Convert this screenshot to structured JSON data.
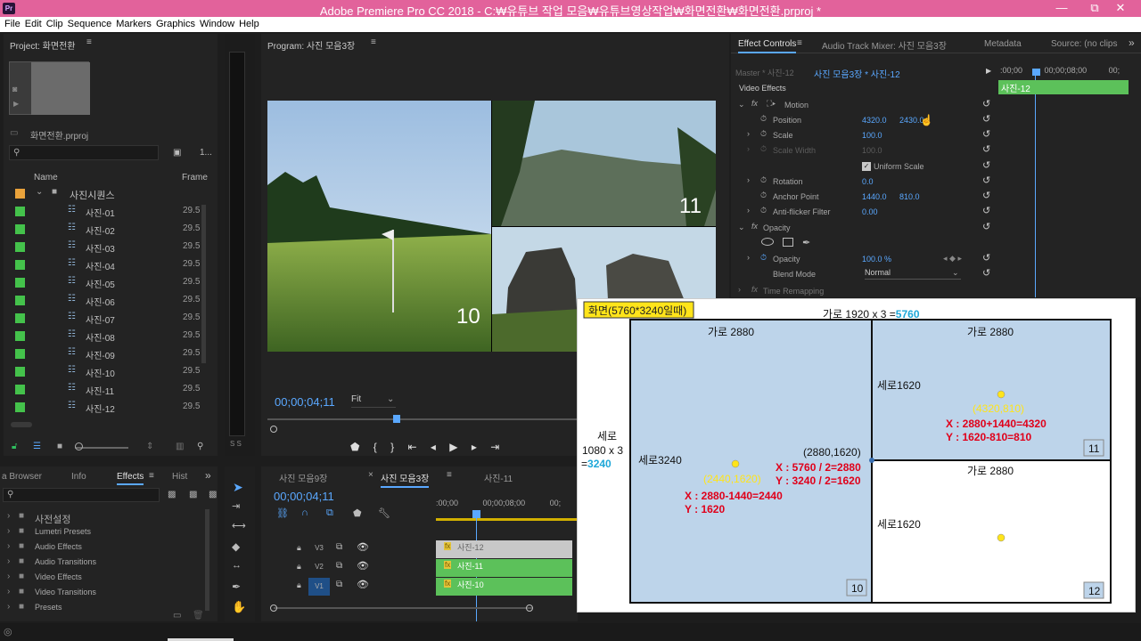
{
  "window": {
    "title": "Adobe Premiere Pro CC 2018 - C:₩유튜브 작업 모음₩유튜브영상작업₩화면전환₩화면전환.prproj *",
    "app_icon": "Pr",
    "minimize": "—",
    "maximize": "⧉",
    "close": "✕"
  },
  "menu": [
    "File",
    "Edit",
    "Clip",
    "Sequence",
    "Markers",
    "Graphics",
    "Window",
    "Help"
  ],
  "project": {
    "title": "Project: 화면전환",
    "file": "화면전환.prproj",
    "count": "1...",
    "col_name": "Name",
    "col_frame": "Frame",
    "folder": "사진시퀀스",
    "items": [
      {
        "name": "사진-01",
        "fps": "29.5"
      },
      {
        "name": "사진-02",
        "fps": "29.5"
      },
      {
        "name": "사진-03",
        "fps": "29.5"
      },
      {
        "name": "사진-04",
        "fps": "29.5"
      },
      {
        "name": "사진-05",
        "fps": "29.5"
      },
      {
        "name": "사진-06",
        "fps": "29.5"
      },
      {
        "name": "사진-07",
        "fps": "29.5"
      },
      {
        "name": "사진-08",
        "fps": "29.5"
      },
      {
        "name": "사진-09",
        "fps": "29.5"
      },
      {
        "name": "사진-10",
        "fps": "29.5"
      },
      {
        "name": "사진-11",
        "fps": "29.5"
      },
      {
        "name": "사진-12",
        "fps": "29.5"
      }
    ]
  },
  "audio_meter": {
    "labels": "S S"
  },
  "program": {
    "title": "Program: 사진 모음3장",
    "timecode": "00;00;04;11",
    "fit": "Fit",
    "num_10": "10",
    "num_11": "11"
  },
  "effect_controls": {
    "tabs": [
      "Effect Controls",
      "Audio Track Mixer: 사진 모음3장",
      "Metadata",
      "Source: (no clips"
    ],
    "master": "Master * 사진-12",
    "sequence": "사진 모음3장 * 사진-12",
    "ruler": [
      ":00;00",
      "00;00;08;00",
      "00;"
    ],
    "clip": "사진-12",
    "section": "Video Effects",
    "motion": "Motion",
    "position_label": "Position",
    "position_x": "4320.0",
    "position_y": "2430.0",
    "scale_label": "Scale",
    "scale": "100.0",
    "scale_width_label": "Scale Width",
    "scale_width": "100.0",
    "uniform_scale": "Uniform Scale",
    "rotation_label": "Rotation",
    "rotation": "0.0",
    "anchor_label": "Anchor Point",
    "anchor_x": "1440.0",
    "anchor_y": "810.0",
    "flicker_label": "Anti-flicker Filter",
    "flicker": "0.00",
    "opacity_section": "Opacity",
    "opacity_label": "Opacity",
    "opacity": "100.0 %",
    "blend_label": "Blend Mode",
    "blend": "Normal",
    "time_remap": "Time Remapping"
  },
  "effects_panel": {
    "tabs": [
      "a Browser",
      "Info",
      "Effects",
      "Hist"
    ],
    "items": [
      "사전설정",
      "Lumetri Presets",
      "Audio Effects",
      "Audio Transitions",
      "Video Effects",
      "Video Transitions",
      "Presets"
    ]
  },
  "timeline": {
    "tabs": [
      "사진 모음9장",
      "사진 모음3장",
      "사진-11"
    ],
    "timecode": "00;00;04;11",
    "ruler": [
      ":00;00",
      "00;00;08;00",
      "00;"
    ],
    "tracks": [
      {
        "label": "V3",
        "clip": "사진-12"
      },
      {
        "label": "V2",
        "clip": "사진-11"
      },
      {
        "label": "V1",
        "clip": "사진-10"
      }
    ]
  },
  "diagram": {
    "badge": "화면(5760*3240일때)",
    "top_label_pre": "가로 1920 x 3 =",
    "top_label_val": "5760",
    "left_l1": "세로",
    "left_l2": "1080 x 3",
    "left_l3_pre": "=",
    "left_l3_val": "3240",
    "big_top": "가로 2880",
    "big_side": "세로3240",
    "big_point": "(2440,1620)",
    "big_x": "X : 2880-1440=2440",
    "big_y": "Y : 1620",
    "corner": "(2880,1620)",
    "corner_x": "X : 5760 / 2=2880",
    "corner_y": "Y : 3240 / 2=1620",
    "tr_top": "가로 2880",
    "tr_side": "세로1620",
    "tr_point": "(4320,810)",
    "tr_x": "X : 2880+1440=4320",
    "tr_y": "Y : 1620-810=810",
    "br_top": "가로 2880",
    "br_side": "세로1620",
    "num10": "10",
    "num11": "11",
    "num12": "12"
  },
  "colors": {
    "accent": "#5aa8ff",
    "title_bar": "#e2629b",
    "clip_green": "#5cc15a",
    "clip_gray": "#c8c8c8",
    "diagram_fill": "#bdd4ea",
    "diagram_red": "#e0001a",
    "diagram_yellow": "#ffe41a"
  }
}
